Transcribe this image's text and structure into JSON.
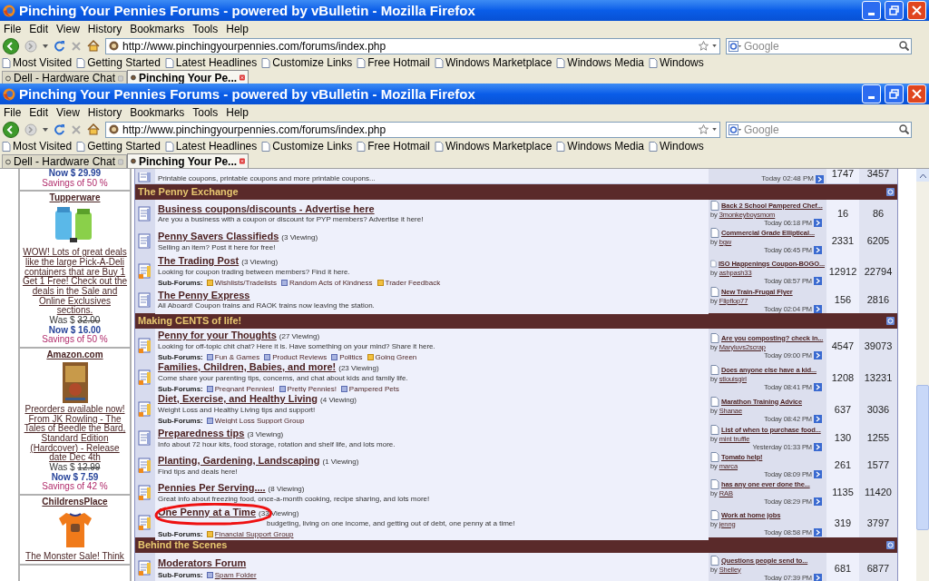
{
  "windows": [
    {
      "title": "Pinching Your Pennies Forums - powered by vBulletin - Mozilla Firefox",
      "menu": [
        "File",
        "Edit",
        "View",
        "History",
        "Bookmarks",
        "Tools",
        "Help"
      ],
      "url": "http://www.pinchingyourpennies.com/forums/index.php",
      "search_placeholder": "Google",
      "bookmarks": [
        "Most Visited",
        "Getting Started",
        "Latest Headlines",
        "Customize Links",
        "Free Hotmail",
        "Windows Marketplace",
        "Windows Media",
        "Windows"
      ],
      "tabs": [
        {
          "label": "Dell - Hardware Chat",
          "selected": false
        },
        {
          "label": "Pinching Your Pe...",
          "selected": true
        }
      ]
    },
    {
      "title": "Pinching Your Pennies Forums - powered by vBulletin - Mozilla Firefox",
      "menu": [
        "File",
        "Edit",
        "View",
        "History",
        "Bookmarks",
        "Tools",
        "Help"
      ],
      "url": "http://www.pinchingyourpennies.com/forums/index.php",
      "search_placeholder": "Google",
      "bookmarks": [
        "Most Visited",
        "Getting Started",
        "Latest Headlines",
        "Customize Links",
        "Free Hotmail",
        "Windows Marketplace",
        "Windows Media",
        "Windows"
      ],
      "tabs": [
        {
          "label": "Dell - Hardware Chat",
          "selected": false
        },
        {
          "label": "Pinching Your Pe...",
          "selected": true
        }
      ]
    }
  ],
  "sidebar": {
    "ads": [
      {
        "now": "Now $ 29.99",
        "savings": "Savings of 50 %"
      },
      {
        "store": "Tupperware",
        "blurb": "WOW! Lots of great deals like the large Pick-A-Deli containers that are Buy 1 Get 1 Free! Check out the deals in the Sale and Online Exclusives sections.",
        "was_label": "Was $",
        "was": "32.00",
        "now": "Now $ 16.00",
        "savings": "Savings of 50 %"
      },
      {
        "store": "Amazon.com",
        "blurb": "Preorders available now! From JK Rowling - The Tales of Beedle the Bard, Standard Edition (Hardcover) - Release date Dec 4th",
        "was_label": "Was $",
        "was": "12.99",
        "now": "Now $ 7.59",
        "savings": "Savings of 42 %"
      },
      {
        "store": "ChildrensPlace",
        "blurb": "The Monster Sale! Think"
      }
    ]
  },
  "forum": {
    "partial_row": {
      "description": "Printable coupons, printable coupons and more printable coupons...",
      "time": "Today 02:48 PM",
      "threads": "1747",
      "posts": "3457"
    },
    "sections": [
      {
        "title": "The Penny Exchange",
        "forums": [
          {
            "title": "Business coupons/discounts - Advertise here",
            "new": false,
            "description": "Are you a business with a coupon or discount for PYP members? Advertise it here!",
            "last_post": {
              "title": "Back 2 School Pampered Chef...",
              "by_label": "by",
              "user": "3monkeyboysmom",
              "time": "Today 06:18 PM"
            },
            "threads": "16",
            "posts": "86"
          },
          {
            "title": "Penny Savers Classifieds",
            "viewing": "(3 Viewing)",
            "new": false,
            "description": "Selling an item? Post it here for free!",
            "last_post": {
              "title": "Commercial Grade Elliptical...",
              "by_label": "by",
              "user": "bgw",
              "time": "Today 06:45 PM"
            },
            "threads": "2331",
            "posts": "6205"
          },
          {
            "title": "The Trading Post",
            "viewing": "(3 Viewing)",
            "new": true,
            "description": "Looking for coupon trading between members? Find it here.",
            "subforums_label": "Sub-Forums:",
            "subforums": [
              {
                "name": "Wishlists/Tradelists",
                "new": true
              },
              {
                "name": "Random Acts of Kindness",
                "new": false
              },
              {
                "name": "Trader Feedback",
                "new": true
              }
            ],
            "last_post": {
              "title": "ISO Happenings Coupon-BOGO...",
              "by_label": "by",
              "user": "ashpash33",
              "time": "Today 08:57 PM"
            },
            "threads": "12912",
            "posts": "22794"
          },
          {
            "title": "The Penny Express",
            "new": false,
            "description": "All Aboard! Coupon trains and RAOK trains now leaving the station.",
            "last_post": {
              "title": "New Train-Frugal Flyer",
              "by_label": "by",
              "user": "Flipflop77",
              "time": "Today 02:04 PM"
            },
            "threads": "156",
            "posts": "2816"
          }
        ]
      },
      {
        "title": "Making CENTS of life!",
        "forums": [
          {
            "title": "Penny for your Thoughts",
            "viewing": "(27 Viewing)",
            "new": true,
            "description": "Looking for off-topic chit chat? Here it is. Have something on your mind? Share it here.",
            "subforums_label": "Sub-Forums:",
            "subforums": [
              {
                "name": "Fun & Games",
                "new": false
              },
              {
                "name": "Product Reviews",
                "new": false
              },
              {
                "name": "Politics",
                "new": false
              },
              {
                "name": "Going Green",
                "new": true
              }
            ],
            "last_post": {
              "title": "Are you composting? check in...",
              "by_label": "by",
              "user": "Maryluvs2scrap",
              "time": "Today 09:00 PM"
            },
            "threads": "4547",
            "posts": "39073"
          },
          {
            "title": "Families, Children, Babies, and more!",
            "viewing": "(23 Viewing)",
            "new": true,
            "description": "Come share your parenting tips, concerns, and chat about kids and family life.",
            "subforums_label": "Sub-Forums:",
            "subforums": [
              {
                "name": "Pregnant Pennies!",
                "new": false
              },
              {
                "name": "Pretty Pennies!",
                "new": false
              },
              {
                "name": "Pampered Pets",
                "new": false
              }
            ],
            "last_post": {
              "title": "Does anyone else have a kid...",
              "by_label": "by",
              "user": "stlouisgirl",
              "time": "Today 08:41 PM"
            },
            "threads": "1208",
            "posts": "13231"
          },
          {
            "title": "Diet, Exercise, and Healthy Living",
            "viewing": "(4 Viewing)",
            "new": true,
            "description": "Weight Loss and Healthy Living tips and support!",
            "subforums_label": "Sub-Forums:",
            "subforums": [
              {
                "name": "Weight Loss Support Group",
                "new": false
              }
            ],
            "last_post": {
              "title": "Marathon Training Advice",
              "by_label": "by",
              "user": "Shanae",
              "time": "Today 08:42 PM"
            },
            "threads": "637",
            "posts": "3036"
          },
          {
            "title": "Preparedness tips",
            "viewing": "(3 Viewing)",
            "new": false,
            "description": "Info about 72 hour kits, food storage, rotation and shelf life, and lots more.",
            "last_post": {
              "title": "List of when to purchase food...",
              "by_label": "by",
              "user": "mint truffle",
              "time": "Yesterday 01:33 PM"
            },
            "threads": "130",
            "posts": "1255"
          },
          {
            "title": "Planting, Gardening, Landscaping",
            "viewing": "(1 Viewing)",
            "new": true,
            "description": "Find tips and deals here!",
            "last_post": {
              "title": "Tomato help!",
              "by_label": "by",
              "user": "marca",
              "time": "Today 08:09 PM"
            },
            "threads": "261",
            "posts": "1577"
          },
          {
            "title": "Pennies Per Serving....",
            "viewing": "(8 Viewing)",
            "new": true,
            "description": "Great info about freezing food, once-a-month cooking, recipe sharing, and lots more!",
            "last_post": {
              "title": "has any one ever done the...",
              "by_label": "by",
              "user": "RAB",
              "time": "Today 08:29 PM"
            },
            "threads": "1135",
            "posts": "11420"
          },
          {
            "title": "One Penny at a Time",
            "viewing": "(33 Viewing)",
            "new": true,
            "circled": true,
            "description": "budgeting, living on one income, and getting out of debt, one penny at a time!",
            "subforums_label": "Sub-Forums:",
            "subforums": [
              {
                "name": "Financial Support Group",
                "new": true
              }
            ],
            "last_post": {
              "title": "Work at home jobs",
              "by_label": "by",
              "user": "jenng",
              "time": "Today 08:58 PM"
            },
            "threads": "319",
            "posts": "3797"
          }
        ]
      },
      {
        "title": "Behind the Scenes",
        "forums": [
          {
            "title": "Moderators Forum",
            "new": true,
            "subforums_label": "Sub-Forums:",
            "subforums": [
              {
                "name": "Spam Folder",
                "new": false
              }
            ],
            "last_post": {
              "title": "Questions people send to...",
              "by_label": "by",
              "user": "Shelley",
              "time": "Today 07:39 PM"
            },
            "threads": "681",
            "posts": "6877"
          }
        ]
      }
    ]
  }
}
